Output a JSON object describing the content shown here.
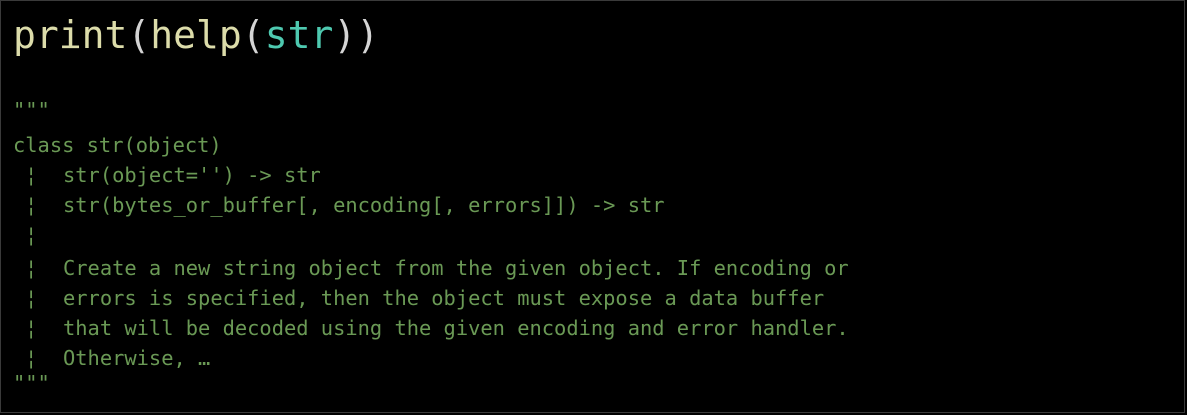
{
  "code": {
    "call": {
      "print": "print",
      "open1": "(",
      "help": "help",
      "open2": "(",
      "arg": "str",
      "close": "))"
    },
    "doc": {
      "open_quotes": "\"\"\"",
      "class_line": "class str(object)",
      "bar": "¦",
      "lines": [
        "str(object='') -> str",
        "str(bytes_or_buffer[, encoding[, errors]]) -> str",
        "",
        "Create a new string object from the given object. If encoding or",
        "errors is specified, then the object must expose a data buffer",
        "that will be decoded using the given encoding and error handler.",
        "Otherwise, …"
      ],
      "close_quotes": "\"\"\""
    }
  },
  "colors": {
    "background": "#000000",
    "function": "#dcdcaa",
    "builtin_class": "#4ec9b0",
    "punctuation": "#d4d4d4",
    "docstring": "#6a9955"
  }
}
